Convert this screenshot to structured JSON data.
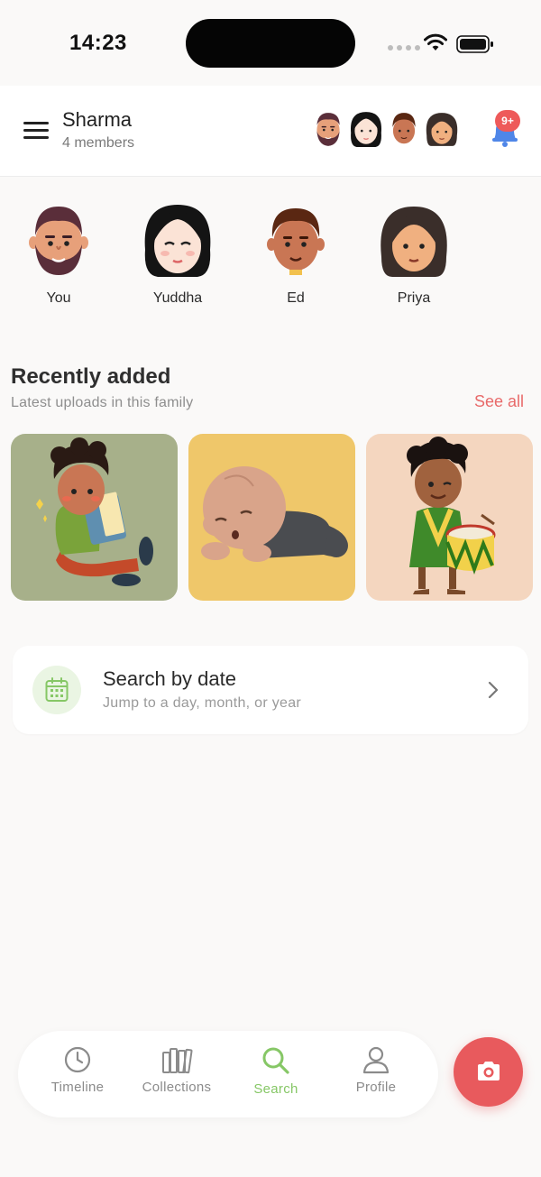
{
  "status_bar": {
    "time": "14:23"
  },
  "header": {
    "family_name": "Sharma",
    "member_count": "4 members",
    "notification_badge": "9+"
  },
  "members": [
    {
      "name": "You",
      "avatar": "bearded-man-avatar"
    },
    {
      "name": "Yuddha",
      "avatar": "black-haired-woman-avatar"
    },
    {
      "name": "Ed",
      "avatar": "boy-avatar"
    },
    {
      "name": "Priya",
      "avatar": "girl-avatar"
    }
  ],
  "recent": {
    "title": "Recently added",
    "subtitle": "Latest uploads in this family",
    "see_all": "See all",
    "thumbnails": [
      {
        "subject": "boy-reading-book-illustration",
        "bg": "#a7b08a"
      },
      {
        "subject": "sleeping-baby-illustration",
        "bg": "#efc76a"
      },
      {
        "subject": "boy-playing-drum-illustration",
        "bg": "#f4d6bf"
      }
    ]
  },
  "search_by_date": {
    "title": "Search by date",
    "subtitle": "Jump to a day, month, or year"
  },
  "bottom_nav": {
    "items": [
      {
        "label": "Timeline",
        "icon": "clock-icon",
        "active": false
      },
      {
        "label": "Collections",
        "icon": "books-icon",
        "active": false
      },
      {
        "label": "Search",
        "icon": "search-icon",
        "active": true
      },
      {
        "label": "Profile",
        "icon": "person-icon",
        "active": false
      }
    ],
    "fab_icon": "camera-icon"
  },
  "colors": {
    "accent_red": "#e85a5d",
    "accent_green": "#86c766",
    "background": "#faf9f8"
  }
}
